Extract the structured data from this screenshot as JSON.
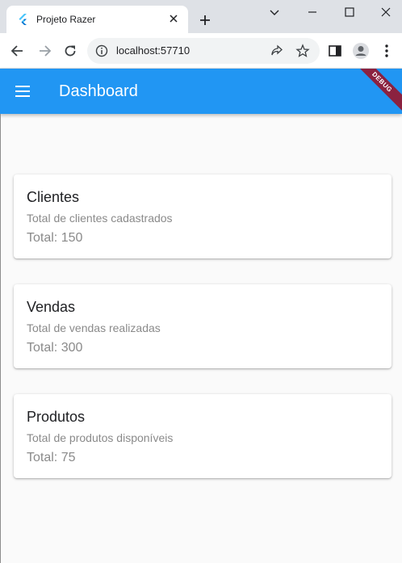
{
  "browser": {
    "tab_title": "Projeto Razer",
    "address": "localhost:57710"
  },
  "app": {
    "title": "Dashboard",
    "ribbon": "DEBUG",
    "accent_color": "#2196f3"
  },
  "cards": [
    {
      "title": "Clientes",
      "subtitle": "Total de clientes cadastrados",
      "total": "Total: 150"
    },
    {
      "title": "Vendas",
      "subtitle": "Total de vendas realizadas",
      "total": "Total: 300"
    },
    {
      "title": "Produtos",
      "subtitle": "Total de produtos disponíveis",
      "total": "Total: 75"
    }
  ]
}
